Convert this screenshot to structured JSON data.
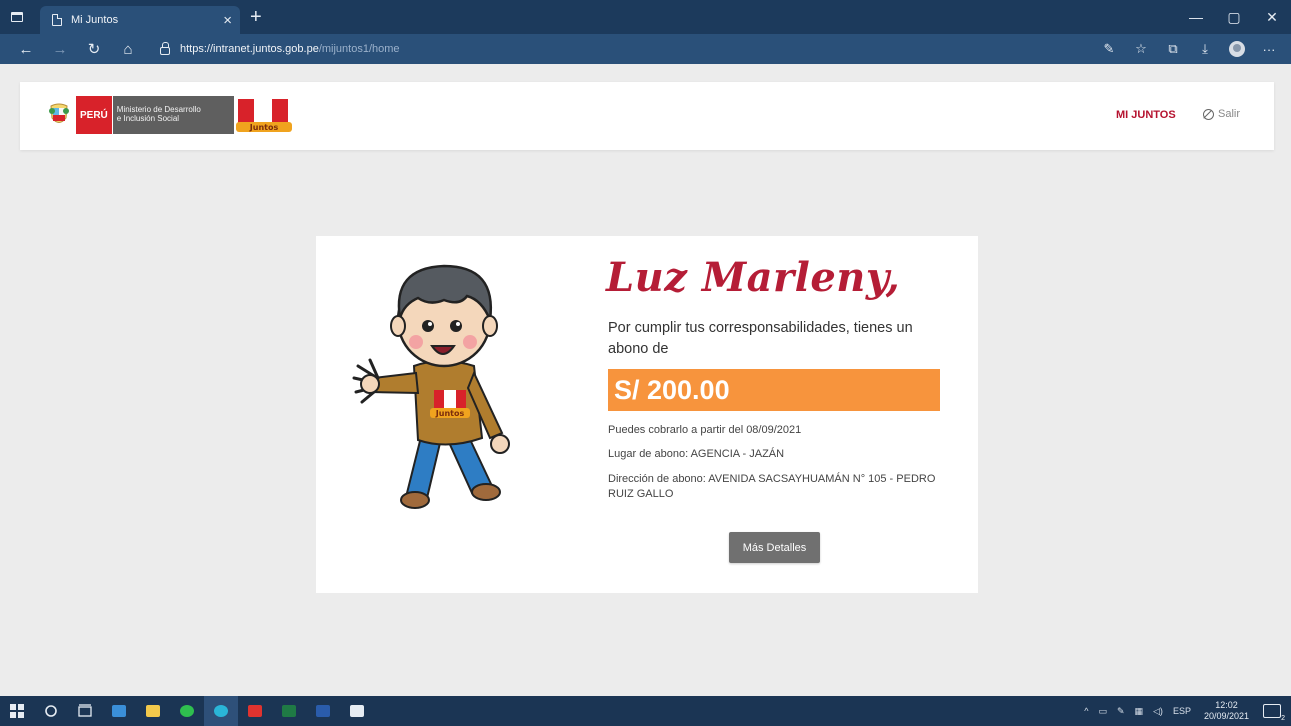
{
  "browser": {
    "tab_title": "Mi Juntos",
    "tab_close": "×",
    "new_tab": "+",
    "url_host": "https://intranet.juntos.gob.pe",
    "url_path": "/mijuntos1/home",
    "window_controls": {
      "minimize": "—",
      "maximize": "▢",
      "close": "✕"
    },
    "nav": {
      "back": "←",
      "forward": "→",
      "refresh": "↻",
      "home": "⌂"
    },
    "toolbar_icons": {
      "read_aloud": "✎",
      "favorites": "☆",
      "collections": "⧉",
      "downloads": "⤓",
      "more": "···"
    }
  },
  "header": {
    "peru_label": "PERÚ",
    "ministerio_line1": "Ministerio de Desarrollo",
    "ministerio_line2": "e Inclusión Social",
    "juntos_label": "Juntos",
    "nav_mijuntos": "MI JUNTOS",
    "nav_salir": "Salir"
  },
  "card": {
    "greeting": "Luz Marleny,",
    "message": "Por cumplir tus corresponsabilidades, tienes un abono de",
    "amount": "S/ 200.00",
    "cobro": "Puedes cobrarlo a partir del 08/09/2021",
    "lugar": "Lugar de abono: AGENCIA - JAZÁN",
    "direccion": "Dirección de abono: AVENIDA SACSAYHUAMÁN N° 105 - PEDRO RUIZ GALLO",
    "button": "Más Detalles",
    "shirt_label": "Juntos"
  },
  "taskbar": {
    "tray_lang": "ESP",
    "clock_time": "12:02",
    "clock_date": "20/09/2021",
    "notification_count": "2"
  },
  "colors": {
    "accent_red": "#b51d36",
    "amount_orange": "#f7943d",
    "button_gray": "#707070",
    "browser_dark": "#1c3a5c"
  }
}
